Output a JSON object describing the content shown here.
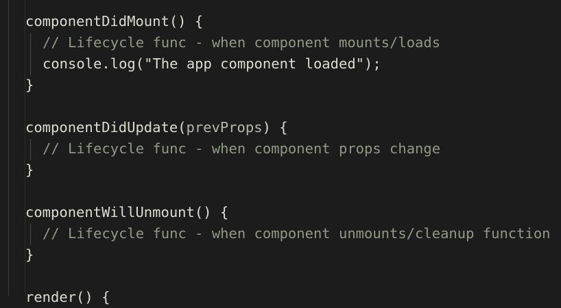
{
  "editor": {
    "lines": [
      {
        "text": "componentDidMount() {"
      },
      {
        "text": "// Lifecycle func - when component mounts/loads",
        "kind": "comment"
      },
      {
        "text": "console.log(\"The app component loaded\");"
      },
      {
        "text": "}"
      },
      {
        "text": ""
      },
      {
        "text": "componentDidUpdate(",
        "param": "prevProps",
        "rest": ") {"
      },
      {
        "text": "// Lifecycle func - when component props change",
        "kind": "comment"
      },
      {
        "text": "}"
      },
      {
        "text": ""
      },
      {
        "text": "componentWillUnmount() {"
      },
      {
        "text": "// Lifecycle func - when component unmounts/cleanup function",
        "kind": "comment"
      },
      {
        "text": "}"
      },
      {
        "text": ""
      },
      {
        "text": "render() {"
      }
    ],
    "colors": {
      "background": "#1c1c1c",
      "text": "#dcdcd0",
      "comment": "#8f9a80"
    }
  }
}
